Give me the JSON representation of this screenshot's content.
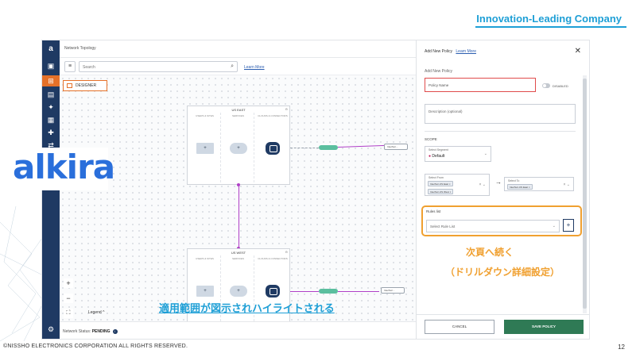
{
  "slide": {
    "brand_tag": "Innovation-Leading Company",
    "copyright": "©NISSHO ELECTRONICS CORPORATION ALL RIGHTS RESERVED.",
    "page_number": "12",
    "logo_text": "alkira",
    "callout_bottom": "適用範囲が図示されハイライトされる",
    "callout_right_line1": "次頁へ続く",
    "callout_right_line2": "（ドリルダウン詳細設定）",
    "accent_blue": "#1e9fd6",
    "accent_orange": "#f0a030"
  },
  "app": {
    "topbar_title": "Network Topology",
    "search_placeholder": "Search",
    "learn_more": "Learn More",
    "designer_label": "DESIGNER",
    "regions": [
      {
        "title": "US EAST",
        "columns": [
          "USERS & SITES",
          "SERVICES",
          "CLOUDS & CONNECTORS"
        ],
        "destination": "InterSvc..."
      },
      {
        "title": "US WEST",
        "columns": [
          "USERS & SITES",
          "SERVICES",
          "CLOUDS & CONNECTORS"
        ],
        "destination": "InterSvc..."
      }
    ],
    "zoom_in": "+",
    "zoom_out": "−",
    "legend": "Legend",
    "status_label": "Network Status:",
    "status_value": "PENDING",
    "nav_primary_color": "#1f3a63"
  },
  "drawer": {
    "title": "Add New Policy",
    "learn_more": "Learn More",
    "subtitle": "Add New Policy",
    "policy_name_placeholder": "Policy Name",
    "toggle_label": "DISABLED",
    "description_placeholder": "Description (optional)",
    "scope_heading": "SCOPE",
    "segment_label": "Select Segment",
    "segment_value": "Default",
    "from_label": "Select From",
    "from_tags": [
      "InterSvc-US East",
      "InterSvc-US West"
    ],
    "to_label": "Select To",
    "to_tags": [
      "InterSvc-US East"
    ],
    "rules_label": "Rules list",
    "rules_placeholder": "Select Rule List",
    "add": "+",
    "cancel": "CANCEL",
    "save": "SAVE POLICY",
    "save_color": "#2f7a55"
  }
}
